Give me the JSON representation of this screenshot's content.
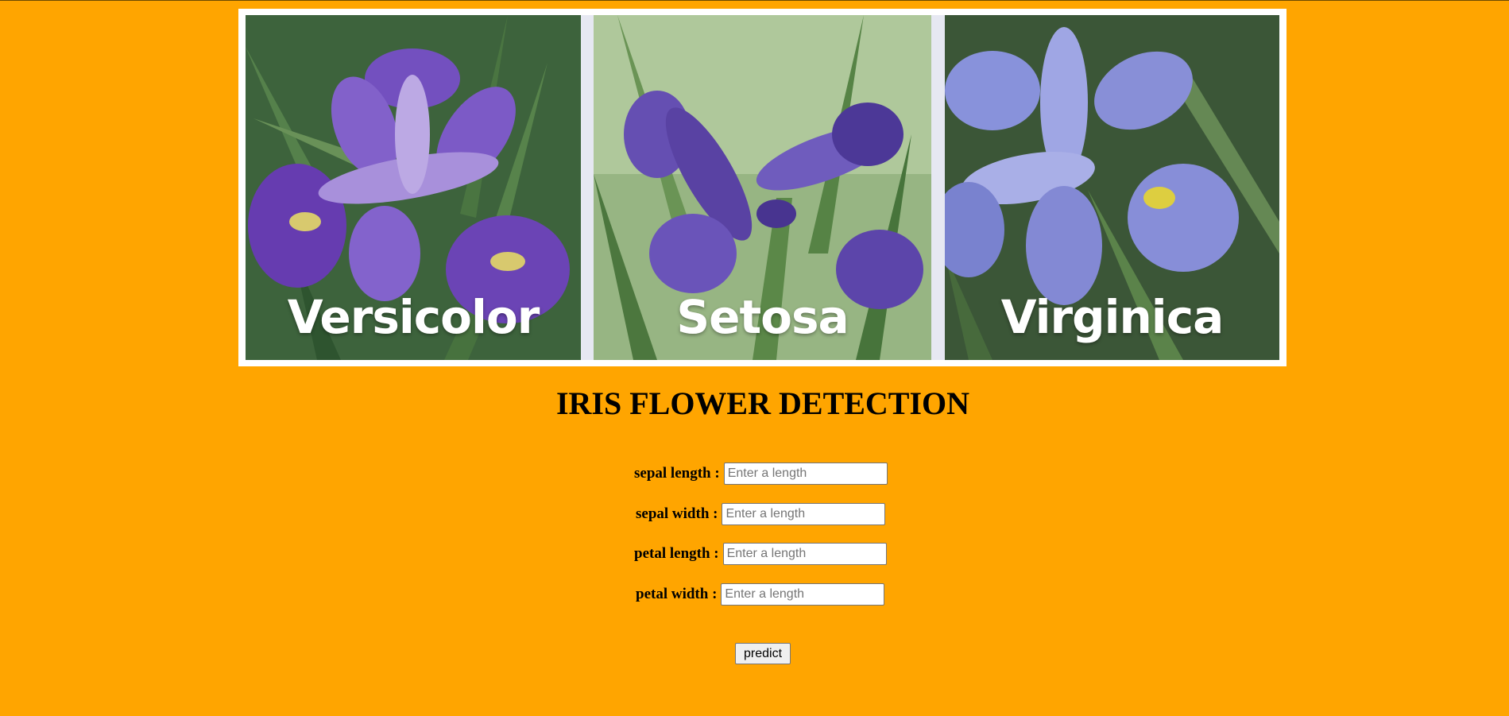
{
  "banner": {
    "panels": [
      {
        "label": "Versicolor",
        "icon": "iris-versicolor-photo"
      },
      {
        "label": "Setosa",
        "icon": "iris-setosa-photo"
      },
      {
        "label": "Virginica",
        "icon": "iris-virginica-photo"
      }
    ]
  },
  "title": "IRIS FLOWER DETECTION",
  "form": {
    "fields": [
      {
        "label": "sepal length :",
        "placeholder": "Enter a length",
        "value": ""
      },
      {
        "label": "sepal width :",
        "placeholder": "Enter a length",
        "value": ""
      },
      {
        "label": "petal length :",
        "placeholder": "Enter a length",
        "value": ""
      },
      {
        "label": "petal width :",
        "placeholder": "Enter a length",
        "value": ""
      }
    ],
    "submit_label": "predict"
  },
  "colors": {
    "background": "#ffa500",
    "banner_frame": "#ffffff",
    "petal_versicolor": "#7a55c8",
    "petal_setosa": "#6a52b8",
    "petal_virginica": "#8f99e3"
  }
}
